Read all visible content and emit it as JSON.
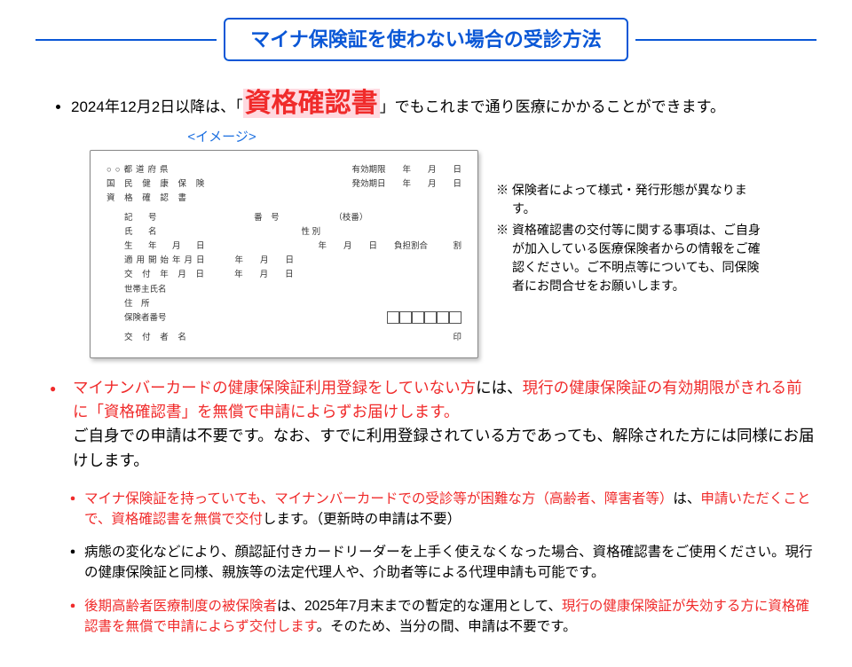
{
  "title": "マイナ保険証を使わない場合の受診方法",
  "top_bullet": {
    "pre": "2024年12月2日以降は、「",
    "highlight": "資格確認書",
    "post": "」でもこれまで通り医療にかかることができます。"
  },
  "image_label": "<イメージ>",
  "card": {
    "line1a": "○○都道府県",
    "line1b": "有効期限　　年　　月　　日",
    "line2a": "国 民 健 康 保 険",
    "line2b": "発効期日　　年　　月　　日",
    "line3": "資 格 確 認 書",
    "row1a": "記　号",
    "row1b": "番　号　　　　　　　（枝番）",
    "row2a": "氏　名",
    "row2b": "性 別",
    "row3a": "生　年　月　日",
    "row3b": "年　　月　　日　　負担割合　　　割",
    "row4a": "適用開始年月日",
    "row4b": "年　　月　　日",
    "row5a": "交 付 年 月 日",
    "row5b": "年　　月　　日",
    "row6": "世帯主氏名",
    "row7": "住　所",
    "row8": "保険者番号",
    "row9a": "交 付 者 名",
    "row9b": "印"
  },
  "notes": {
    "n1": "※ 保険者によって様式・発行形態が異なります。",
    "n2": "※ 資格確認書の交付等に関する事項は、ご自身が加入している医療保険者からの情報をご確認ください。ご不明点等についても、同保険者にお問合せをお願いします。"
  },
  "main_bullet": {
    "p1_red1": "マイナンバーカードの健康保険証利用登録をしていない方",
    "p1_mid": "には、",
    "p1_red2": "現行の健康保険証の有効期限がきれる前に「資格確認書」を無償で申請によらずお届けします。",
    "p2": "ご自身での申請は不要です。なお、すでに利用登録されている方であっても、解除された方には同様にお届けします。"
  },
  "sub": {
    "s1a": "マイナ保険証を持っていても、マイナンバーカードでの受診等が困難な方（高齢者、障害者等）",
    "s1b": "は、",
    "s1c": "申請いただくことで、資格確認書を無償で交付",
    "s1d": "します。（更新時の申請は不要）",
    "s2": "病態の変化などにより、顔認証付きカードリーダーを上手く使えなくなった場合、資格確認書をご使用ください。現行の健康保険証と同様、親族等の法定代理人や、介助者等による代理申請も可能です。",
    "s3a": "後期高齢者医療制度の被保険者",
    "s3b": "は、2025年7月末までの暫定的な運用として、",
    "s3c": "現行の健康保険証が失効する方に資格確認書を無償で申請によらず交付します",
    "s3d": "。そのため、当分の間、申請は不要です。"
  }
}
